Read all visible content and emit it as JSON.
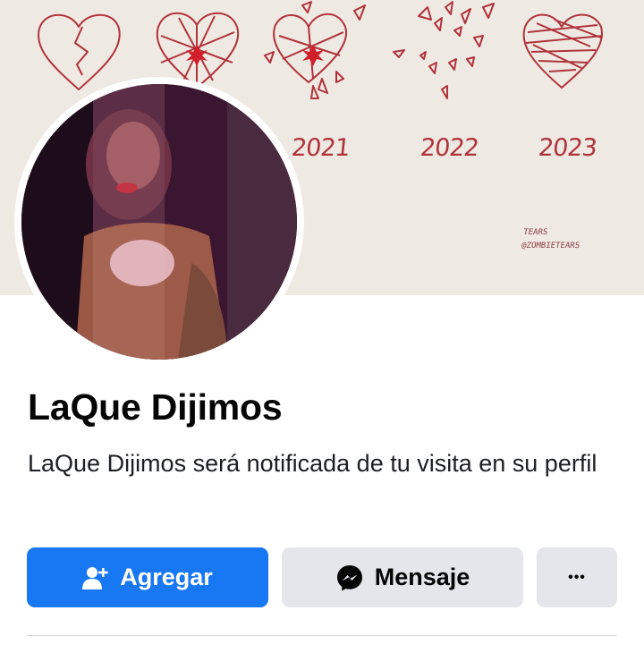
{
  "cover": {
    "years": [
      "2021",
      "2022",
      "2023"
    ],
    "credit_line1": "Tears",
    "credit_line2": "@zombietears"
  },
  "profile": {
    "name": "LaQue Dijimos",
    "visit_notice": "LaQue Dijimos será notificada de tu visita en su perfil"
  },
  "actions": {
    "add_label": "Agregar",
    "message_label": "Mensaje",
    "more_label": "•••"
  },
  "colors": {
    "primary_blue": "#1877f2",
    "secondary_gray": "#e4e6eb",
    "cover_background": "#efe9e4",
    "heart_red": "#b0333a"
  },
  "icons": {
    "add": "add-friend-icon",
    "message": "messenger-icon",
    "more": "more-options-icon"
  }
}
